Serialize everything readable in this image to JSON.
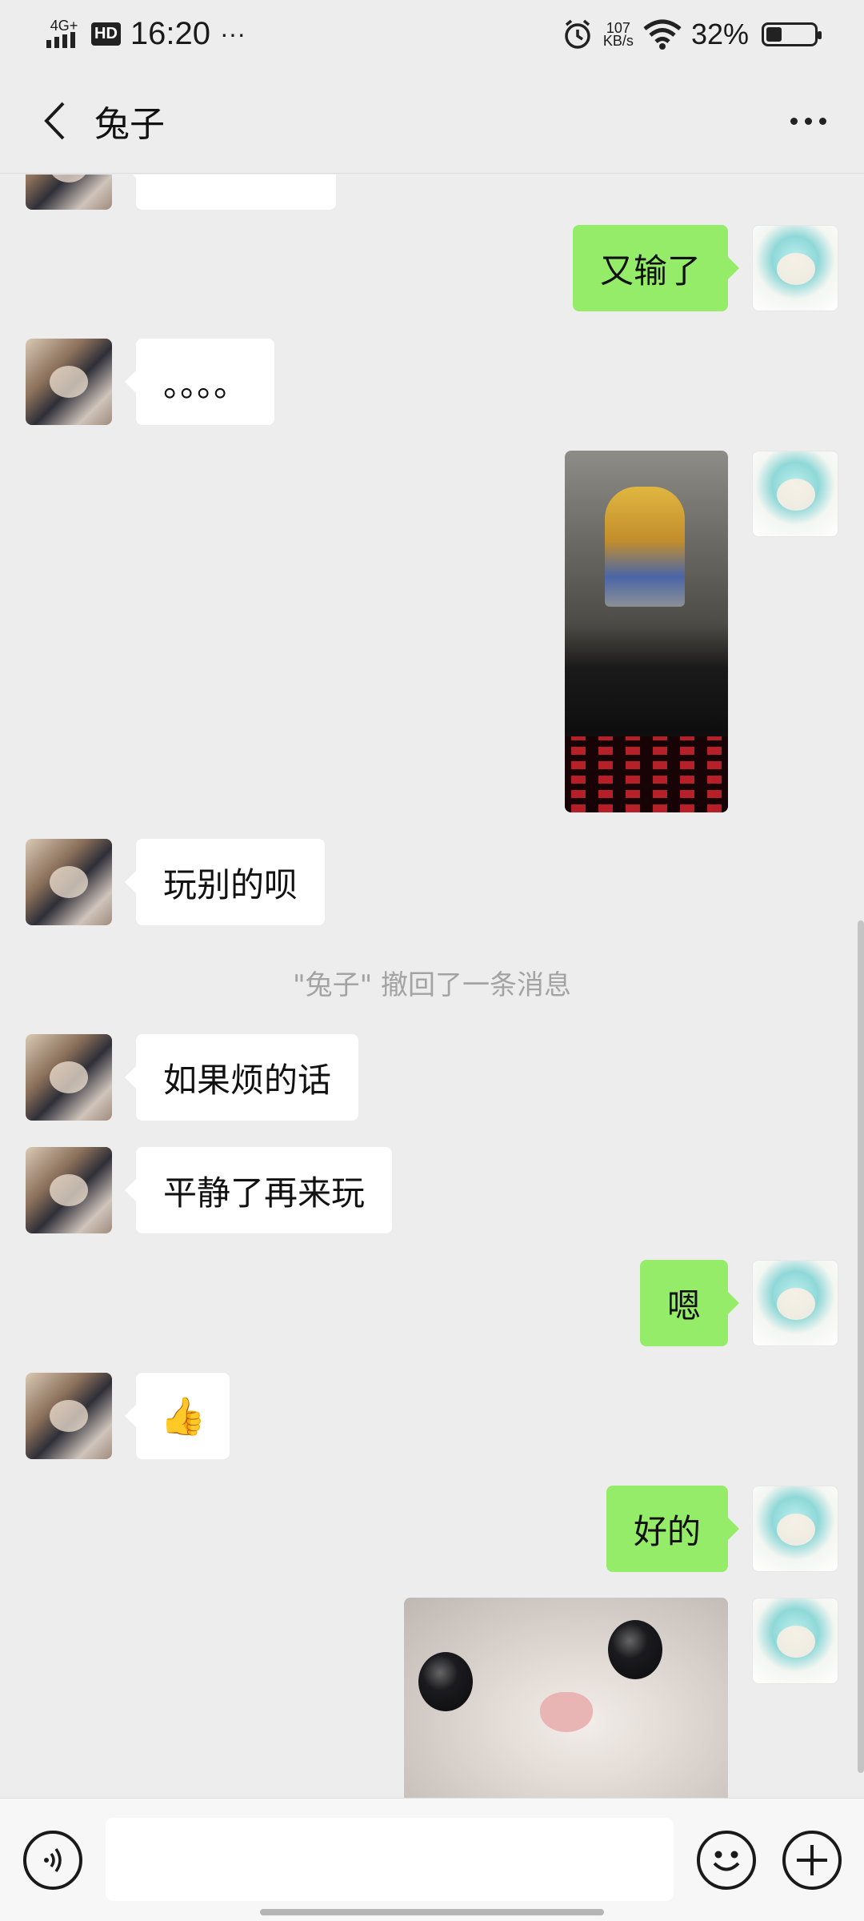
{
  "status_bar": {
    "network": "4G+",
    "hd": "HD",
    "time": "16:20",
    "more": "···",
    "speed_value": "107",
    "speed_unit": "KB/s",
    "battery_pct": "32%",
    "battery_level": 0.32
  },
  "header": {
    "title": "兔子"
  },
  "messages": [
    {
      "side": "in",
      "type": "text",
      "text": ""
    },
    {
      "side": "out",
      "type": "text",
      "text": "又输了"
    },
    {
      "side": "in",
      "type": "text",
      "text": "。。。。"
    },
    {
      "side": "out",
      "type": "image",
      "image": "game-photo"
    },
    {
      "side": "in",
      "type": "text",
      "text": "玩别的呗"
    },
    {
      "type": "system",
      "text": "\"兔子\" 撤回了一条消息"
    },
    {
      "side": "in",
      "type": "text",
      "text": "如果烦的话"
    },
    {
      "side": "in",
      "type": "text",
      "text": "平静了再来玩"
    },
    {
      "side": "out",
      "type": "text",
      "text": "嗯"
    },
    {
      "side": "in",
      "type": "emoji",
      "text": "👍"
    },
    {
      "side": "out",
      "type": "text",
      "text": "好的"
    },
    {
      "side": "out",
      "type": "image",
      "image": "cat-photo"
    }
  ],
  "input": {
    "placeholder": "",
    "voice_icon": "voice-icon",
    "emoji_icon": "emoji-icon",
    "plus_icon": "plus-icon"
  },
  "colors": {
    "background": "#ededed",
    "outgoing_bubble": "#95ec69",
    "incoming_bubble": "#ffffff",
    "system_text": "#a3a3a3"
  }
}
